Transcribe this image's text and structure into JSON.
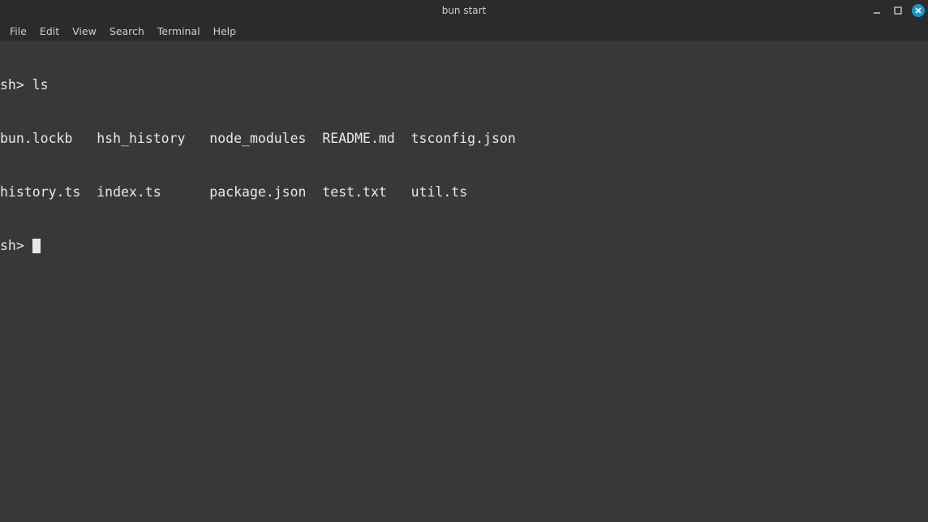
{
  "window": {
    "title": "bun start"
  },
  "menubar": {
    "items": [
      "File",
      "Edit",
      "View",
      "Search",
      "Terminal",
      "Help"
    ]
  },
  "terminal": {
    "lines": [
      "sh> ls",
      "bun.lockb   hsh_history   node_modules  README.md  tsconfig.json",
      "history.ts  index.ts      package.json  test.txt   util.ts"
    ],
    "prompt": "sh> "
  }
}
